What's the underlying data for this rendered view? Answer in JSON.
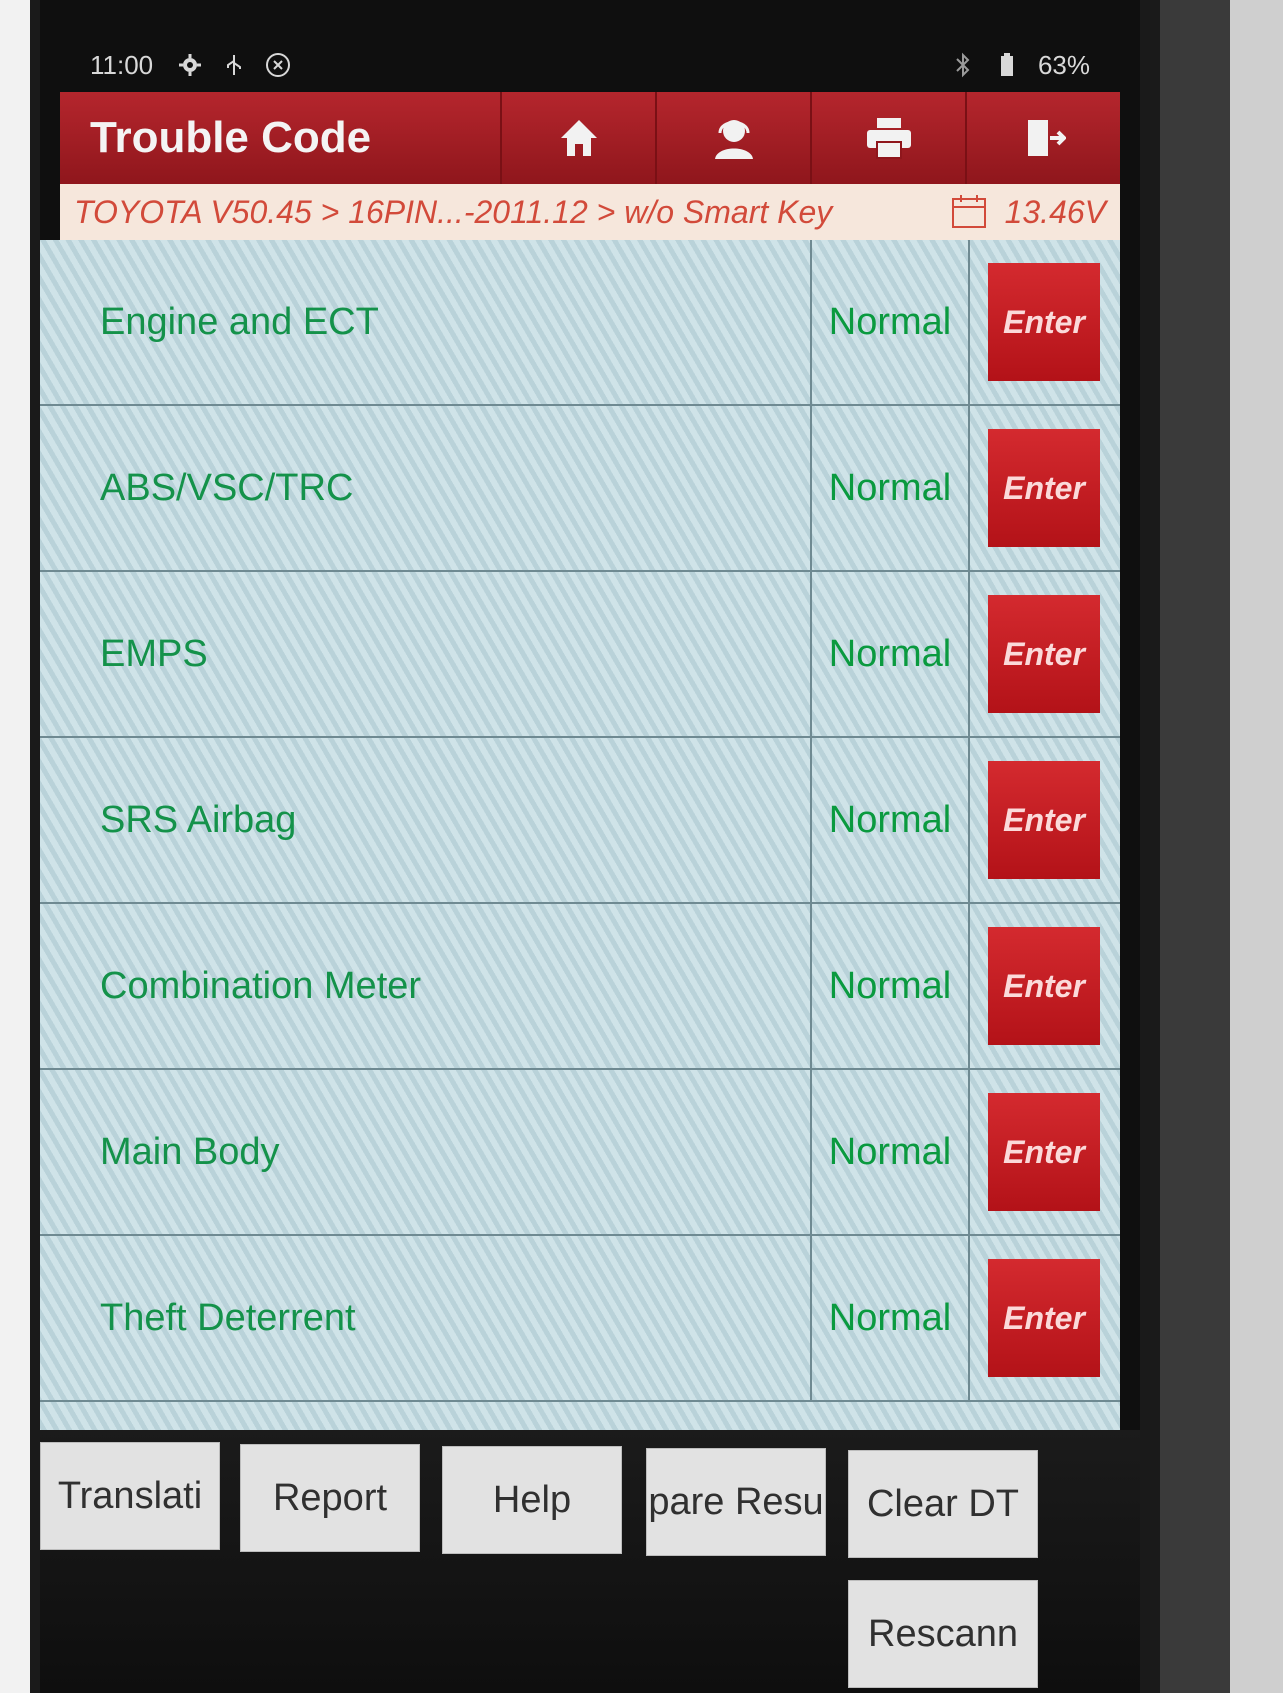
{
  "status_bar": {
    "time": "11:00",
    "battery": "63%",
    "icons": [
      "gear-icon",
      "usb-icon",
      "vci-icon",
      "bluetooth-icon",
      "battery-icon"
    ]
  },
  "header": {
    "title": "Trouble Code",
    "buttons": [
      {
        "name": "home",
        "icon": "home-icon"
      },
      {
        "name": "support",
        "icon": "technician-icon"
      },
      {
        "name": "print",
        "icon": "printer-icon"
      },
      {
        "name": "exit",
        "icon": "exit-icon"
      }
    ]
  },
  "breadcrumb": {
    "path": "TOYOTA V50.45 > 16PIN...-2011.12 > w/o Smart Key",
    "voltage": "13.46V"
  },
  "systems": [
    {
      "name": "Engine and ECT",
      "status": "Normal",
      "action": "Enter"
    },
    {
      "name": "ABS/VSC/TRC",
      "status": "Normal",
      "action": "Enter"
    },
    {
      "name": "EMPS",
      "status": "Normal",
      "action": "Enter"
    },
    {
      "name": "SRS Airbag",
      "status": "Normal",
      "action": "Enter"
    },
    {
      "name": "Combination Meter",
      "status": "Normal",
      "action": "Enter"
    },
    {
      "name": "Main Body",
      "status": "Normal",
      "action": "Enter"
    },
    {
      "name": "Theft Deterrent",
      "status": "Normal",
      "action": "Enter"
    }
  ],
  "toolbar": {
    "translate": "Translati",
    "report": "Report",
    "help": "Help",
    "compare": "pare Resu",
    "clear": "Clear DT",
    "rescan": "Rescann"
  },
  "colors": {
    "header_red": "#a51f26",
    "button_red": "#c8181e",
    "status_green": "#0a9a3f"
  }
}
